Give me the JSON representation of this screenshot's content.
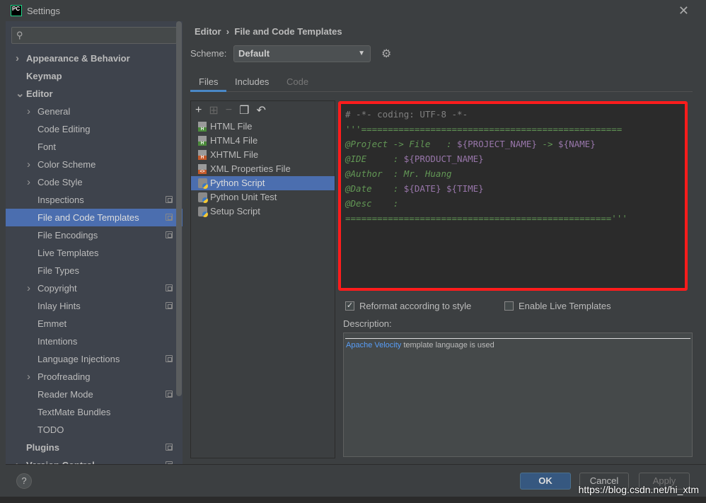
{
  "window": {
    "title": "Settings",
    "logo": "PC"
  },
  "sidebar": {
    "items": [
      {
        "label": "Appearance & Behavior",
        "level": 0,
        "arrow": true,
        "bold": true
      },
      {
        "label": "Keymap",
        "level": 0,
        "bold": true
      },
      {
        "label": "Editor",
        "level": 0,
        "arrow": "open",
        "bold": true
      },
      {
        "label": "General",
        "level": 1,
        "arrow": true
      },
      {
        "label": "Code Editing",
        "level": 1
      },
      {
        "label": "Font",
        "level": 1
      },
      {
        "label": "Color Scheme",
        "level": 1,
        "arrow": true
      },
      {
        "label": "Code Style",
        "level": 1,
        "arrow": true
      },
      {
        "label": "Inspections",
        "level": 1,
        "copy": true
      },
      {
        "label": "File and Code Templates",
        "level": 1,
        "copy": true,
        "selected": true
      },
      {
        "label": "File Encodings",
        "level": 1,
        "copy": true
      },
      {
        "label": "Live Templates",
        "level": 1
      },
      {
        "label": "File Types",
        "level": 1
      },
      {
        "label": "Copyright",
        "level": 1,
        "arrow": true,
        "copy": true
      },
      {
        "label": "Inlay Hints",
        "level": 1,
        "copy": true
      },
      {
        "label": "Emmet",
        "level": 1
      },
      {
        "label": "Intentions",
        "level": 1
      },
      {
        "label": "Language Injections",
        "level": 1,
        "copy": true
      },
      {
        "label": "Proofreading",
        "level": 1,
        "arrow": true
      },
      {
        "label": "Reader Mode",
        "level": 1,
        "copy": true
      },
      {
        "label": "TextMate Bundles",
        "level": 1
      },
      {
        "label": "TODO",
        "level": 1
      },
      {
        "label": "Plugins",
        "level": 0,
        "bold": true,
        "copy": true
      },
      {
        "label": "Version Control",
        "level": 0,
        "arrow": true,
        "bold": true,
        "copy": true
      }
    ]
  },
  "breadcrumb": {
    "parent": "Editor",
    "sep": "›",
    "current": "File and Code Templates"
  },
  "scheme": {
    "label": "Scheme:",
    "value": "Default"
  },
  "tabs": [
    {
      "label": "Files",
      "active": true
    },
    {
      "label": "Includes"
    },
    {
      "label": "Code",
      "disabled": true
    }
  ],
  "templates": [
    {
      "label": "HTML File",
      "icon": "html",
      "color": "#4b8b3b"
    },
    {
      "label": "HTML4 File",
      "icon": "html",
      "color": "#4b8b3b"
    },
    {
      "label": "XHTML File",
      "icon": "html",
      "color": "#c55a2a"
    },
    {
      "label": "XML Properties File",
      "icon": "xml",
      "color": "#c55a2a"
    },
    {
      "label": "Python Script",
      "icon": "python",
      "selected": true
    },
    {
      "label": "Python Unit Test",
      "icon": "python"
    },
    {
      "label": "Setup Script",
      "icon": "python"
    }
  ],
  "editor": {
    "lines": [
      [
        {
          "t": "# -*- coding: UTF-8 -*-",
          "c": "c"
        }
      ],
      [
        {
          "t": "'''=================================================",
          "c": "gi"
        }
      ],
      [
        {
          "t": "@Project -> File   : ",
          "c": "gi"
        },
        {
          "t": "${PROJECT_NAME}",
          "c": "v"
        },
        {
          "t": " -> ",
          "c": "gi"
        },
        {
          "t": "${NAME}",
          "c": "v"
        }
      ],
      [
        {
          "t": "@IDE     : ",
          "c": "gi"
        },
        {
          "t": "${PRODUCT_NAME}",
          "c": "v"
        }
      ],
      [
        {
          "t": "@Author  : Mr. Huang",
          "c": "gi"
        }
      ],
      [
        {
          "t": "@Date    : ",
          "c": "gi"
        },
        {
          "t": "${DATE}",
          "c": "v"
        },
        {
          "t": " ",
          "c": "gi"
        },
        {
          "t": "${TIME}",
          "c": "v"
        }
      ],
      [
        {
          "t": "@Desc    :",
          "c": "gi"
        }
      ],
      [
        {
          "t": "==================================================",
          "c": "g"
        },
        {
          "t": "'''",
          "c": "gi"
        }
      ]
    ]
  },
  "options": {
    "reformat": {
      "label": "Reformat according to style",
      "checked": true
    },
    "live": {
      "label": "Enable Live Templates",
      "checked": false
    }
  },
  "description": {
    "label": "Description:",
    "link": "Apache Velocity",
    "text": " template language is used"
  },
  "footer": {
    "help": "?",
    "ok": "OK",
    "cancel": "Cancel",
    "apply": "Apply"
  },
  "watermark": "https://blog.csdn.net/hi_xtm"
}
